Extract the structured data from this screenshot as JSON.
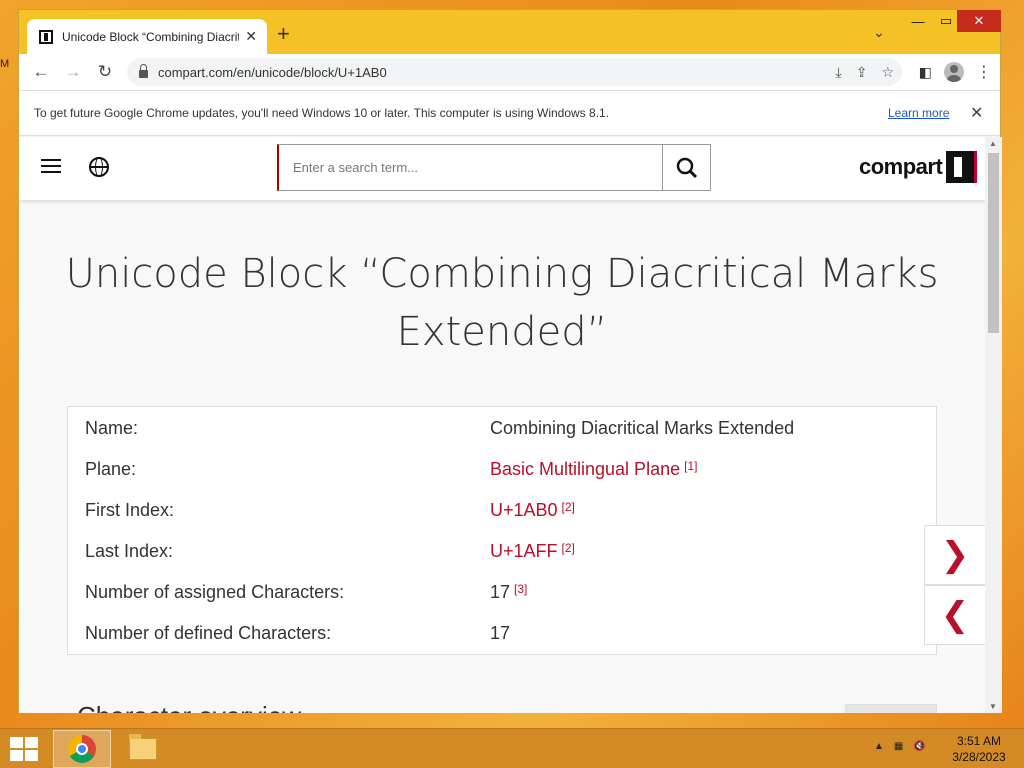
{
  "browser": {
    "tab_title": "Unicode Block “Combining Diacritical Marks Extended”",
    "url": "compart.com/en/unicode/block/U+1AB0",
    "infobar_text": "To get future Google Chrome updates, you'll need Windows 10 or later. This computer is using Windows 8.1.",
    "learn_more": "Learn more"
  },
  "site": {
    "search_placeholder": "Enter a search term...",
    "logo_text": "compart"
  },
  "page": {
    "title": "Unicode Block “Combining Diacritical Marks Extended”",
    "rows": [
      {
        "label": "Name:",
        "value": "Combining Diacritical Marks Extended",
        "ref": ""
      },
      {
        "label": "Plane:",
        "value": "Basic Multilingual Plane",
        "ref": "[1]"
      },
      {
        "label": "First Index:",
        "value": "U+1AB0",
        "ref": "[2]"
      },
      {
        "label": "Last Index:",
        "value": "U+1AFF",
        "ref": "[2]"
      },
      {
        "label": "Number of assigned Characters:",
        "value": "17",
        "ref": "[3]"
      },
      {
        "label": "Number of defined Characters:",
        "value": "17",
        "ref": ""
      }
    ],
    "next_glyph": "❯",
    "prev_glyph": "❮",
    "cut_heading": "Character overview"
  },
  "taskbar": {
    "time": "3:51 AM",
    "date": "3/28/2023"
  },
  "icons": [
    "tab-favicon-icon",
    "new-tab-icon",
    "back-icon",
    "forward-icon",
    "reload-icon",
    "lock-icon",
    "download-icon",
    "share-icon",
    "star-icon",
    "sidepanel-icon",
    "profile-icon",
    "menu-icon",
    "hamburger-icon",
    "globe-icon",
    "search-icon",
    "chrome-icon",
    "file-explorer-icon"
  ]
}
